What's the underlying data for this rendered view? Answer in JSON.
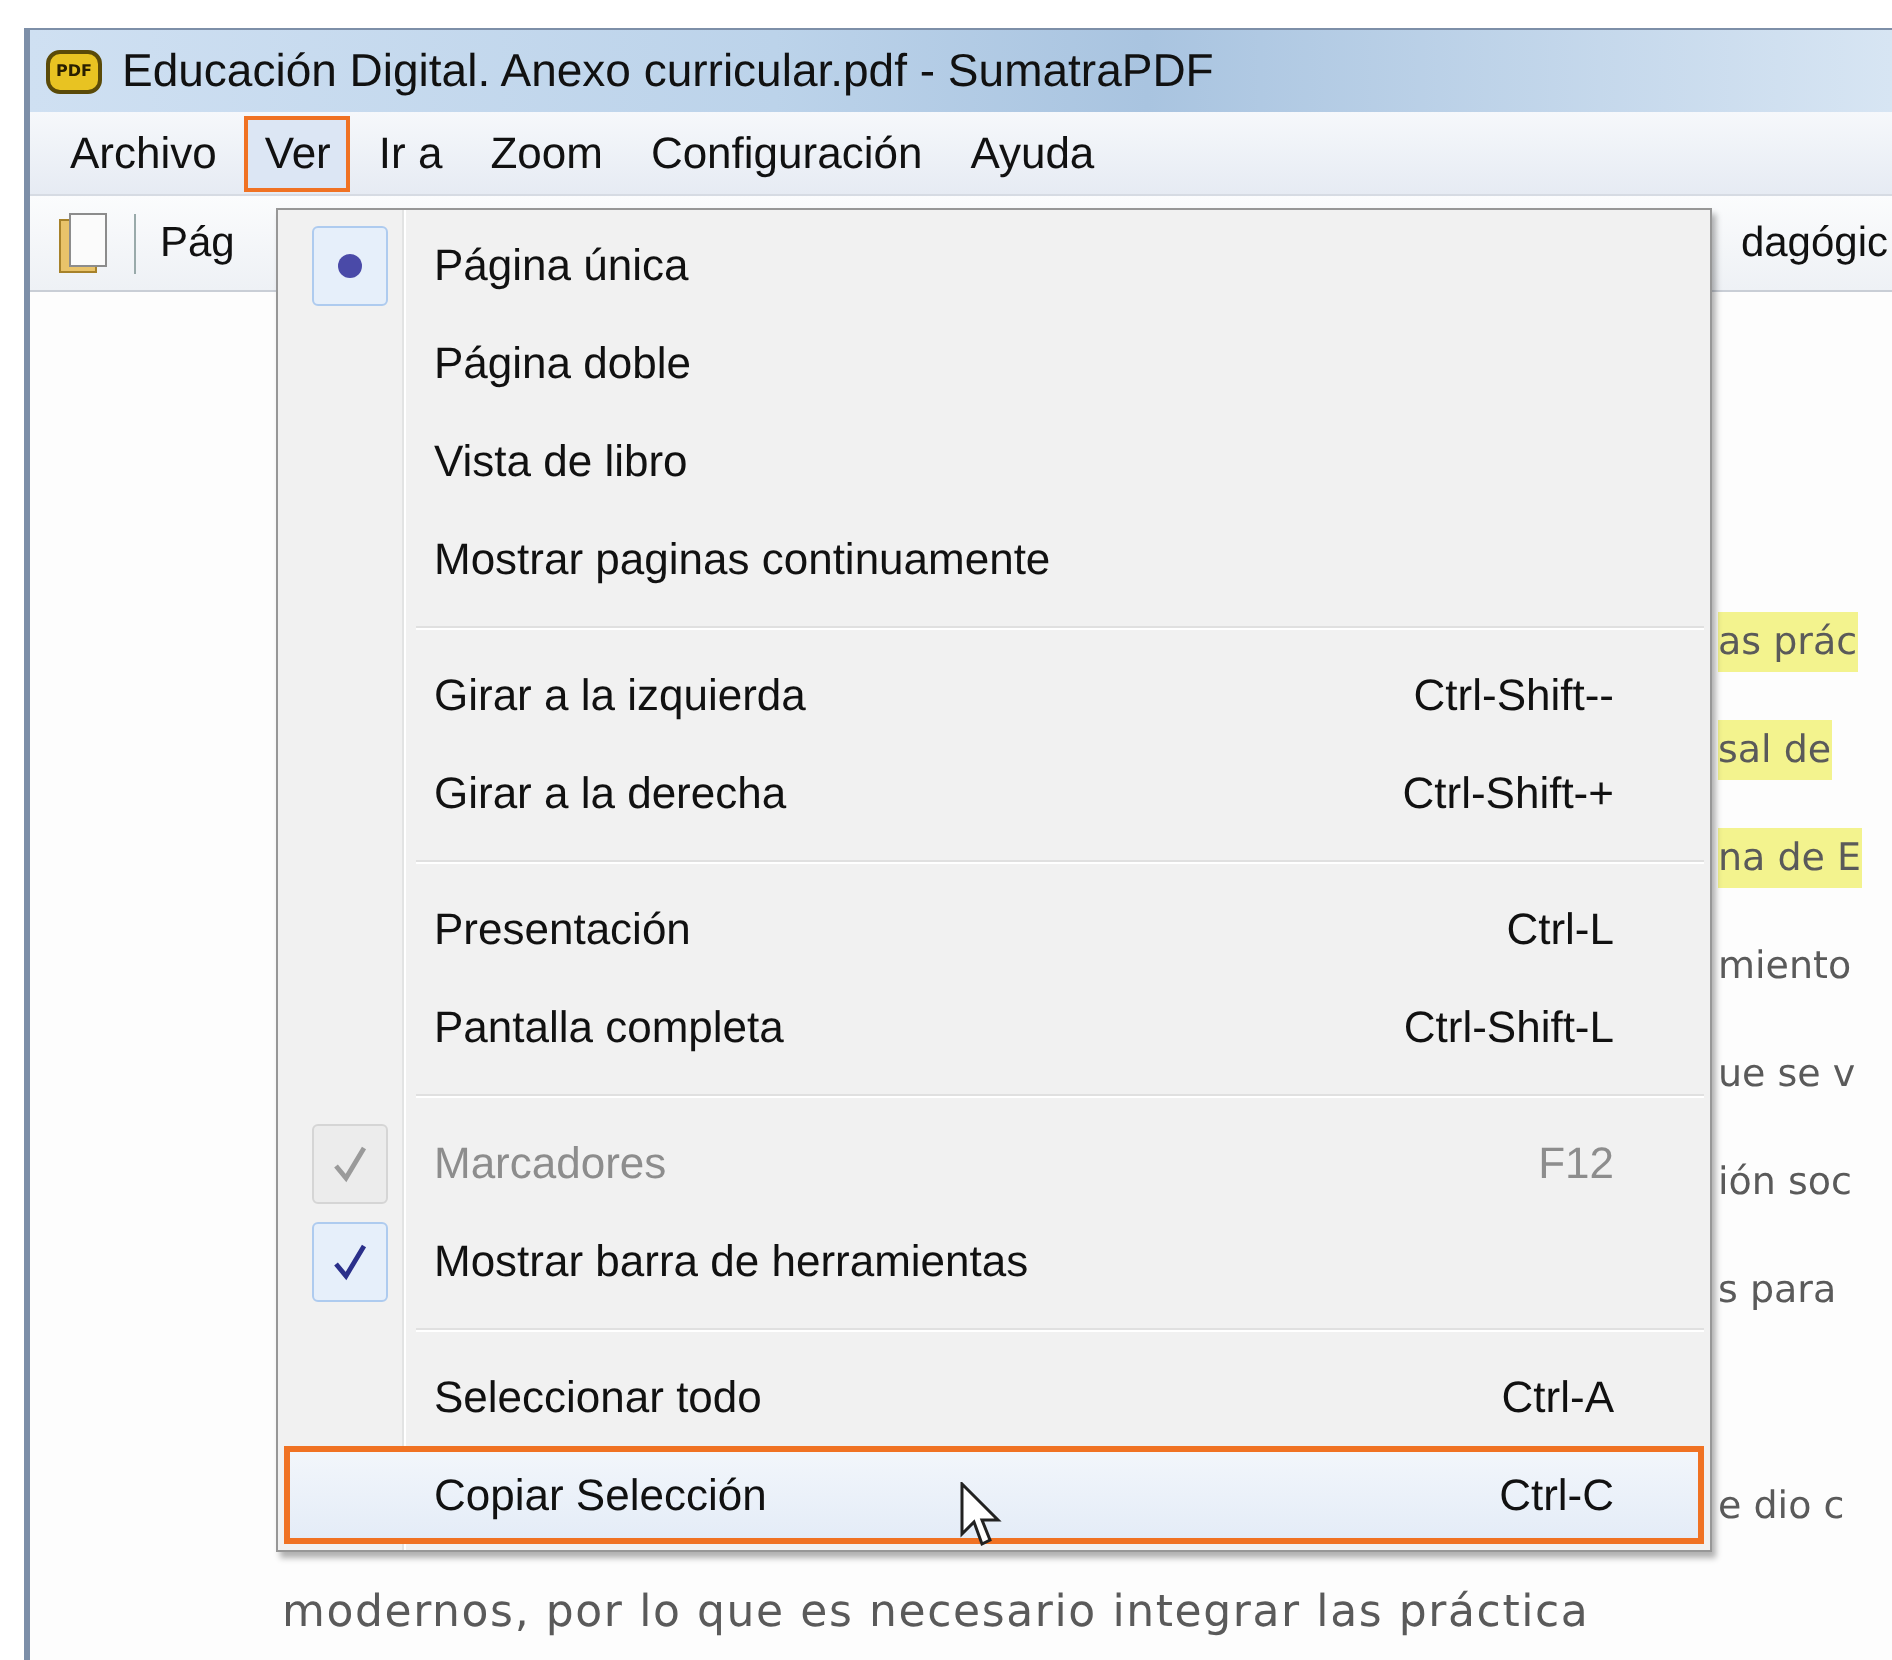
{
  "window": {
    "title": "Educación Digital. Anexo curricular.pdf - SumatraPDF",
    "app_icon_label": "PDF"
  },
  "menu_bar": [
    {
      "label": "Archivo",
      "selected": false,
      "annotated": false
    },
    {
      "label": "Ver",
      "selected": true,
      "annotated": true
    },
    {
      "label": "Ir a",
      "selected": false,
      "annotated": false
    },
    {
      "label": "Zoom",
      "selected": false,
      "annotated": false
    },
    {
      "label": "Configuración",
      "selected": false,
      "annotated": false
    },
    {
      "label": "Ayuda",
      "selected": false,
      "annotated": false
    }
  ],
  "toolbar": {
    "page_label": "Pág",
    "title_fragment": "dagógic"
  },
  "menu": {
    "groups": [
      [
        {
          "kind": "radio",
          "label": "Página única",
          "checked": true,
          "disabled": false,
          "selected": false,
          "annotated": false
        },
        {
          "kind": "radio",
          "label": "Página doble",
          "checked": false,
          "disabled": false,
          "selected": false,
          "annotated": false
        },
        {
          "kind": "radio",
          "label": "Vista de libro",
          "checked": false,
          "disabled": false,
          "selected": false,
          "annotated": false
        },
        {
          "kind": "plain",
          "label": "Mostrar paginas continuamente",
          "disabled": false,
          "selected": false,
          "annotated": false
        }
      ],
      [
        {
          "kind": "plain",
          "label": "Girar a la izquierda",
          "shortcut": "Ctrl-Shift--",
          "disabled": false,
          "selected": false,
          "annotated": false
        },
        {
          "kind": "plain",
          "label": "Girar a la derecha",
          "shortcut": "Ctrl-Shift-+",
          "disabled": false,
          "selected": false,
          "annotated": false
        }
      ],
      [
        {
          "kind": "plain",
          "label": "Presentación",
          "shortcut": "Ctrl-L",
          "disabled": false,
          "selected": false,
          "annotated": false
        },
        {
          "kind": "plain",
          "label": "Pantalla completa",
          "shortcut": "Ctrl-Shift-L",
          "disabled": false,
          "selected": false,
          "annotated": false
        }
      ],
      [
        {
          "kind": "check",
          "label": "Marcadores",
          "shortcut": "F12",
          "checked": true,
          "disabled": true,
          "selected": false,
          "annotated": false
        },
        {
          "kind": "check",
          "label": "Mostrar barra de herramientas",
          "checked": true,
          "disabled": false,
          "selected": false,
          "annotated": false
        }
      ],
      [
        {
          "kind": "plain",
          "label": "Seleccionar todo",
          "shortcut": "Ctrl-A",
          "disabled": false,
          "selected": false,
          "annotated": false
        },
        {
          "kind": "plain",
          "label": "Copiar Selección",
          "shortcut": "Ctrl-C",
          "disabled": false,
          "selected": true,
          "annotated": true
        }
      ]
    ]
  },
  "document": {
    "paragraphs": [
      [
        {
          "kind": "fragment",
          "text": "as prác",
          "highlighted": true
        },
        {
          "kind": "fragment",
          "text": "sal de",
          "highlighted": true
        },
        {
          "kind": "fragment",
          "text": "na de E",
          "highlighted": true
        },
        {
          "kind": "fragment",
          "text": "miento",
          "highlighted": false
        },
        {
          "kind": "fragment",
          "text": "ue se v",
          "highlighted": false
        },
        {
          "kind": "fragment",
          "text": "ión soc",
          "highlighted": false
        },
        {
          "kind": "fragment",
          "text": "s para",
          "highlighted": false
        }
      ],
      [
        {
          "kind": "fragment",
          "text": "e dio c",
          "highlighted": false
        },
        {
          "kind": "full",
          "text": "modernos, por lo que es necesario integrar las práctica",
          "highlighted": false
        }
      ]
    ]
  }
}
